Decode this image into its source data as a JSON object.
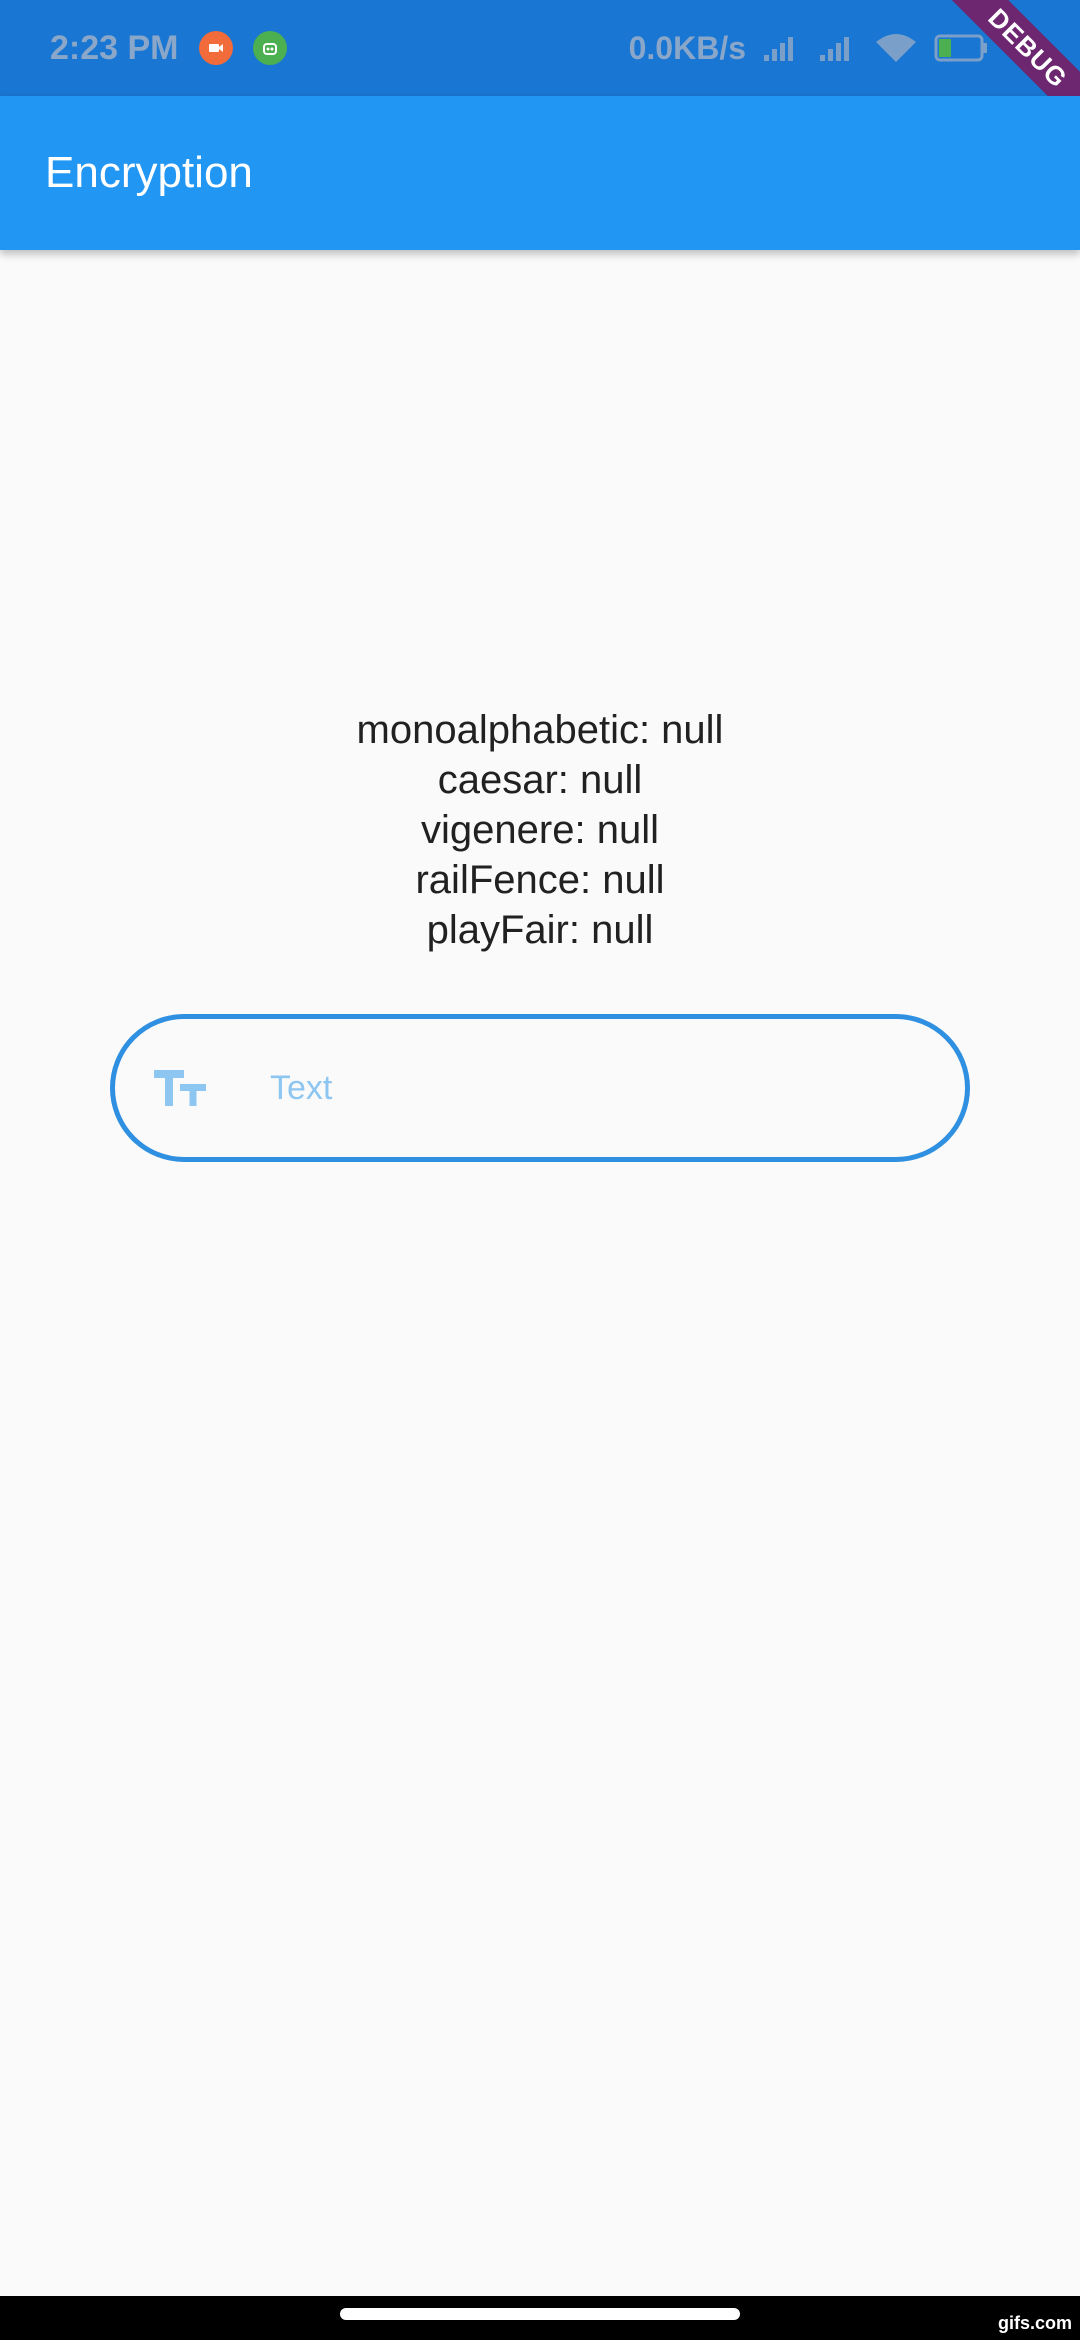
{
  "status_bar": {
    "time": "2:23 PM",
    "net_speed": "0.0KB/s",
    "battery": "26",
    "icons": [
      "screen-record-icon",
      "robot-icon",
      "signal-icon",
      "signal-icon",
      "wifi-icon",
      "battery-icon",
      "charging-icon"
    ]
  },
  "debug_banner": "DEBUG",
  "app_bar": {
    "title": "Encryption"
  },
  "results": [
    "monoalphabetic: null",
    "caesar: null",
    "vigenere: null",
    "railFence: null",
    "playFair: null"
  ],
  "text_field": {
    "placeholder": "Text",
    "value": "",
    "icon": "text-fields-icon"
  },
  "watermark": "gifs.com",
  "colors": {
    "status_bar": "#1976d2",
    "app_bar": "#2196f3",
    "field_border": "#2f8fe0",
    "placeholder": "#8ec6f2"
  }
}
